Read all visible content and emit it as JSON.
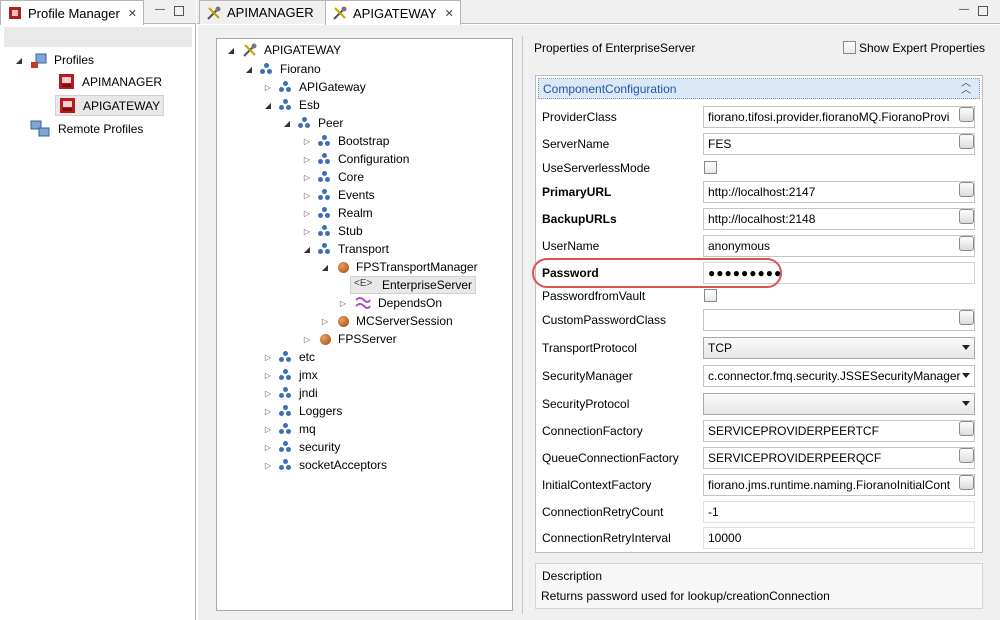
{
  "left_panel": {
    "tab_title": "Profile Manager",
    "tree": {
      "profiles_label": "Profiles",
      "apimanager_label": "APIMANAGER",
      "apigateway_label": "APIGATEWAY",
      "remote_label": "Remote Profiles"
    }
  },
  "editor_tabs": [
    {
      "label": "APIMANAGER"
    },
    {
      "label": "APIGATEWAY"
    }
  ],
  "config_tree": {
    "root": "APIGATEWAY",
    "fiorano": "Fiorano",
    "apigateway": "APIGateway",
    "esb": "Esb",
    "peer": "Peer",
    "bootstrap": "Bootstrap",
    "configuration": "Configuration",
    "core": "Core",
    "events": "Events",
    "realm": "Realm",
    "stub": "Stub",
    "transport": "Transport",
    "fpstm": "FPSTransportManager",
    "enterprise": "EnterpriseServer",
    "dependson": "DependsOn",
    "mcserver": "MCServerSession",
    "fpsserver": "FPSServer",
    "etc": "etc",
    "jmx": "jmx",
    "jndi": "jndi",
    "loggers": "Loggers",
    "mq": "mq",
    "security": "security",
    "socket": "socketAcceptors",
    "enterprise_badge": "<E>"
  },
  "properties": {
    "title": "Properties of EnterpriseServer",
    "expert_label": "Show Expert Properties",
    "section_title": "ComponentConfiguration",
    "rows": {
      "provider_class": {
        "label": "ProviderClass",
        "value": "fiorano.tifosi.provider.fioranoMQ.FioranoProvi"
      },
      "server_name": {
        "label": "ServerName",
        "value": "FES"
      },
      "serverless": {
        "label": "UseServerlessMode"
      },
      "primary_url": {
        "label": "PrimaryURL",
        "value": "http://localhost:2147"
      },
      "backup_urls": {
        "label": "BackupURLs",
        "value": "http://localhost:2148"
      },
      "user_name": {
        "label": "UserName",
        "value": "anonymous"
      },
      "password": {
        "label": "Password",
        "value": "●●●●●●●●●"
      },
      "pwd_vault": {
        "label": "PasswordfromVault"
      },
      "custom_pwd": {
        "label": "CustomPasswordClass",
        "value": ""
      },
      "transport": {
        "label": "TransportProtocol",
        "value": "TCP"
      },
      "sec_manager": {
        "label": "SecurityManager",
        "value": "c.connector.fmq.security.JSSESecurityManager"
      },
      "sec_protocol": {
        "label": "SecurityProtocol",
        "value": ""
      },
      "conn_factory": {
        "label": "ConnectionFactory",
        "value": "SERVICEPROVIDERPEERTCF"
      },
      "queue_factory": {
        "label": "QueueConnectionFactory",
        "value": "SERVICEPROVIDERPEERQCF"
      },
      "initial_ctx": {
        "label": "InitialContextFactory",
        "value": "fiorano.jms.runtime.naming.FioranoInitialCont"
      },
      "retry_count": {
        "label": "ConnectionRetryCount",
        "value": "-1"
      },
      "retry_interval": {
        "label": "ConnectionRetryInterval",
        "value": "10000"
      }
    },
    "description": {
      "title": "Description",
      "text": "Returns password used for lookup/creationConnection"
    }
  },
  "colors": {
    "highlight_ring": "#d9534f",
    "section_text": "#1f57a8",
    "section_bg": "#dde8f7"
  }
}
